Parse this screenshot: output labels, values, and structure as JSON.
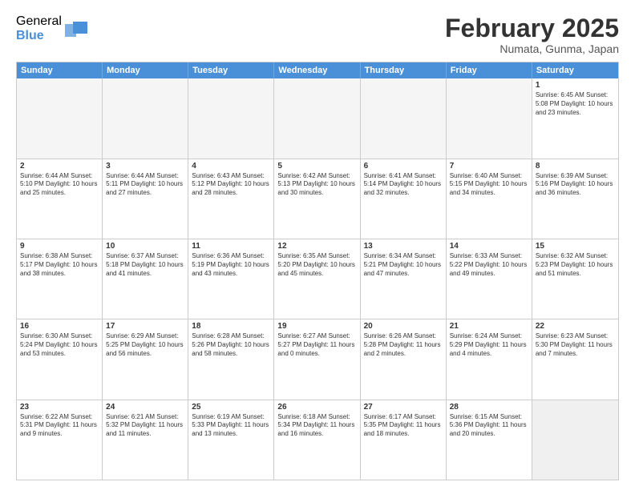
{
  "logo": {
    "general": "General",
    "blue": "Blue"
  },
  "title": "February 2025",
  "location": "Numata, Gunma, Japan",
  "days": [
    "Sunday",
    "Monday",
    "Tuesday",
    "Wednesday",
    "Thursday",
    "Friday",
    "Saturday"
  ],
  "rows": [
    [
      {
        "day": "",
        "text": "",
        "empty": true
      },
      {
        "day": "",
        "text": "",
        "empty": true
      },
      {
        "day": "",
        "text": "",
        "empty": true
      },
      {
        "day": "",
        "text": "",
        "empty": true
      },
      {
        "day": "",
        "text": "",
        "empty": true
      },
      {
        "day": "",
        "text": "",
        "empty": true
      },
      {
        "day": "1",
        "text": "Sunrise: 6:45 AM\nSunset: 5:08 PM\nDaylight: 10 hours and 23 minutes."
      }
    ],
    [
      {
        "day": "2",
        "text": "Sunrise: 6:44 AM\nSunset: 5:10 PM\nDaylight: 10 hours and 25 minutes."
      },
      {
        "day": "3",
        "text": "Sunrise: 6:44 AM\nSunset: 5:11 PM\nDaylight: 10 hours and 27 minutes."
      },
      {
        "day": "4",
        "text": "Sunrise: 6:43 AM\nSunset: 5:12 PM\nDaylight: 10 hours and 28 minutes."
      },
      {
        "day": "5",
        "text": "Sunrise: 6:42 AM\nSunset: 5:13 PM\nDaylight: 10 hours and 30 minutes."
      },
      {
        "day": "6",
        "text": "Sunrise: 6:41 AM\nSunset: 5:14 PM\nDaylight: 10 hours and 32 minutes."
      },
      {
        "day": "7",
        "text": "Sunrise: 6:40 AM\nSunset: 5:15 PM\nDaylight: 10 hours and 34 minutes."
      },
      {
        "day": "8",
        "text": "Sunrise: 6:39 AM\nSunset: 5:16 PM\nDaylight: 10 hours and 36 minutes."
      }
    ],
    [
      {
        "day": "9",
        "text": "Sunrise: 6:38 AM\nSunset: 5:17 PM\nDaylight: 10 hours and 38 minutes."
      },
      {
        "day": "10",
        "text": "Sunrise: 6:37 AM\nSunset: 5:18 PM\nDaylight: 10 hours and 41 minutes."
      },
      {
        "day": "11",
        "text": "Sunrise: 6:36 AM\nSunset: 5:19 PM\nDaylight: 10 hours and 43 minutes."
      },
      {
        "day": "12",
        "text": "Sunrise: 6:35 AM\nSunset: 5:20 PM\nDaylight: 10 hours and 45 minutes."
      },
      {
        "day": "13",
        "text": "Sunrise: 6:34 AM\nSunset: 5:21 PM\nDaylight: 10 hours and 47 minutes."
      },
      {
        "day": "14",
        "text": "Sunrise: 6:33 AM\nSunset: 5:22 PM\nDaylight: 10 hours and 49 minutes."
      },
      {
        "day": "15",
        "text": "Sunrise: 6:32 AM\nSunset: 5:23 PM\nDaylight: 10 hours and 51 minutes."
      }
    ],
    [
      {
        "day": "16",
        "text": "Sunrise: 6:30 AM\nSunset: 5:24 PM\nDaylight: 10 hours and 53 minutes."
      },
      {
        "day": "17",
        "text": "Sunrise: 6:29 AM\nSunset: 5:25 PM\nDaylight: 10 hours and 56 minutes."
      },
      {
        "day": "18",
        "text": "Sunrise: 6:28 AM\nSunset: 5:26 PM\nDaylight: 10 hours and 58 minutes."
      },
      {
        "day": "19",
        "text": "Sunrise: 6:27 AM\nSunset: 5:27 PM\nDaylight: 11 hours and 0 minutes."
      },
      {
        "day": "20",
        "text": "Sunrise: 6:26 AM\nSunset: 5:28 PM\nDaylight: 11 hours and 2 minutes."
      },
      {
        "day": "21",
        "text": "Sunrise: 6:24 AM\nSunset: 5:29 PM\nDaylight: 11 hours and 4 minutes."
      },
      {
        "day": "22",
        "text": "Sunrise: 6:23 AM\nSunset: 5:30 PM\nDaylight: 11 hours and 7 minutes."
      }
    ],
    [
      {
        "day": "23",
        "text": "Sunrise: 6:22 AM\nSunset: 5:31 PM\nDaylight: 11 hours and 9 minutes."
      },
      {
        "day": "24",
        "text": "Sunrise: 6:21 AM\nSunset: 5:32 PM\nDaylight: 11 hours and 11 minutes."
      },
      {
        "day": "25",
        "text": "Sunrise: 6:19 AM\nSunset: 5:33 PM\nDaylight: 11 hours and 13 minutes."
      },
      {
        "day": "26",
        "text": "Sunrise: 6:18 AM\nSunset: 5:34 PM\nDaylight: 11 hours and 16 minutes."
      },
      {
        "day": "27",
        "text": "Sunrise: 6:17 AM\nSunset: 5:35 PM\nDaylight: 11 hours and 18 minutes."
      },
      {
        "day": "28",
        "text": "Sunrise: 6:15 AM\nSunset: 5:36 PM\nDaylight: 11 hours and 20 minutes."
      },
      {
        "day": "",
        "text": "",
        "empty": true,
        "shaded": true
      }
    ]
  ]
}
